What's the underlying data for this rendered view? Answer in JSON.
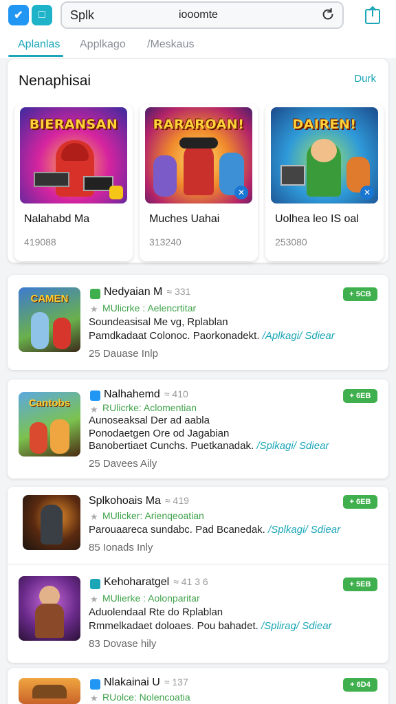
{
  "colors": {
    "accent": "#1aa6b7",
    "green": "#3fb04d",
    "blue": "#2196f3"
  },
  "topbar": {
    "search_value": "Splk",
    "search_center": "iooomte",
    "icons": [
      "app-icon-a",
      "app-icon-b",
      "refresh-icon",
      "share-icon"
    ]
  },
  "tabs": [
    {
      "label": "Aplanlas"
    },
    {
      "label": "Applkago"
    },
    {
      "label": "/Meskaus"
    }
  ],
  "featured": {
    "title": "Nenaphisai",
    "more": "Durk",
    "cards": [
      {
        "art_title": "BIERANSAN",
        "name": "Nalahabd Ma",
        "count": "419088"
      },
      {
        "art_title": "RARAROAN!",
        "name": "Muches Uahai",
        "count": "313240"
      },
      {
        "art_title": "DAIREN!",
        "name": "Uolhea leo IS oal",
        "count": "253080"
      }
    ]
  },
  "items": [
    {
      "thumb_label": "CAMEN",
      "title": "Nedyaian M",
      "rating": "≈ 331",
      "sub": "MUlicrke : Aelencrtitar",
      "desc1": "Soundeasisal Me vg, Rplablan",
      "desc2_text": "Pamdkadaat Colonoc. Paorkonadekt.",
      "desc2_link": "/Aplkagi/ Sdiear",
      "meta": "25 Dauase Inlp",
      "pill": "+ 5CB"
    },
    {
      "thumb_label": "Cantobs",
      "title": "Nalhahemd",
      "rating": "≈ 410",
      "sub": "RUlicrke: Aclomentian",
      "desc1": "Aunoseaksal Der ad aabla",
      "desc2_text": "Ponodaetgen Ore od Jagabian",
      "desc3_text": "Banobertiaet Cunchs. Puetkanadak.",
      "desc3_link": "/Splkagi/ Sdiear",
      "meta": "25 Davees Aily",
      "pill": "+ 6EB"
    },
    {
      "thumb_label": "",
      "title": "Splkohoais Ma",
      "rating": "≈ 419",
      "sub": "MUlicker: Arienqeoatian",
      "desc1": "Parouaareca sundabc. Pad Bcanedak.",
      "desc1_link": "/Splkagi/ Sdiear",
      "meta": "85 Ionads Inly",
      "pill": "+ 6EB"
    },
    {
      "thumb_label": "",
      "title": "Kehoharatgel",
      "rating": "≈ 41 3 6",
      "sub": "MUlierke : Aolonparitar",
      "desc1": "Aduolendaal Rte do Rplablan",
      "desc2_text": "Rmmelkadaet doloaes. Pou bahadet.",
      "desc2_link": "/Splirag/ Sdiear",
      "meta": "83 Dovase hily",
      "pill": "+ 5EB"
    },
    {
      "thumb_label": "",
      "title": "Nlakainai U",
      "rating": "≈ 137",
      "sub": "RUolce: Nolencoatia",
      "pill": "+ 6D4"
    }
  ]
}
